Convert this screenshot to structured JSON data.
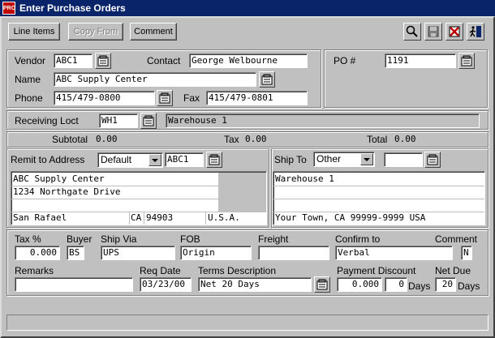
{
  "window": {
    "title": "Enter Purchase Orders",
    "app_icon": "PRO"
  },
  "toolbar": {
    "line_items": "Line Items",
    "copy_from": "Copy From",
    "comment": "Comment",
    "icons": [
      "search-icon",
      "save-icon",
      "delete-icon",
      "exit-icon"
    ]
  },
  "vendor": {
    "vendor_label": "Vendor",
    "vendor_value": "ABC1",
    "contact_label": "Contact",
    "contact_value": "George Welbourne",
    "name_label": "Name",
    "name_value": "ABC Supply Center",
    "phone_label": "Phone",
    "phone_value": "415/479-0800",
    "fax_label": "Fax",
    "fax_value": "415/479-0801"
  },
  "po": {
    "label": "PO #",
    "value": "1191"
  },
  "receiving": {
    "label": "Receiving Loct",
    "code": "WH1",
    "description": "Warehouse 1"
  },
  "totals": {
    "subtotal_label": "Subtotal",
    "subtotal_value": "0.00",
    "tax_label": "Tax",
    "tax_value": "0.00",
    "total_label": "Total",
    "total_value": "0.00"
  },
  "remit": {
    "label": "Remit to Address",
    "select_value": "Default",
    "code": "ABC1",
    "line1": "ABC Supply Center",
    "line2": "1234 Northgate Drive",
    "city": "San Rafael",
    "state": "CA",
    "zip": "94903",
    "country": "U.S.A."
  },
  "shipto": {
    "label": "Ship To",
    "select_value": "Other",
    "code": "",
    "line1": "Warehouse 1",
    "line_last": "Your Town, CA 99999-9999 USA"
  },
  "terms": {
    "tax_pct_label": "Tax %",
    "tax_pct_value": "0.000",
    "buyer_label": "Buyer",
    "buyer_value": "BS",
    "ship_via_label": "Ship Via",
    "ship_via_value": "UPS",
    "fob_label": "FOB",
    "fob_value": "Origin",
    "freight_label": "Freight",
    "freight_value": "",
    "confirm_label": "Confirm to",
    "confirm_value": "Verbal",
    "comment_label": "Comment",
    "comment_value": "N",
    "remarks_label": "Remarks",
    "remarks_value": "",
    "req_date_label": "Req Date",
    "req_date_value": "03/23/00",
    "terms_desc_label": "Terms Description",
    "terms_desc_value": "Net 20 Days",
    "payment_discount_label": "Payment Discount",
    "payment_discount_value": "0.000",
    "discount_days_value": "0",
    "days_label": "Days",
    "net_due_label": "Net Due",
    "net_due_value": "20",
    "net_days_label": "Days"
  },
  "colors": {
    "titlebar": "#0a246a",
    "window": "#c0c0c0"
  }
}
